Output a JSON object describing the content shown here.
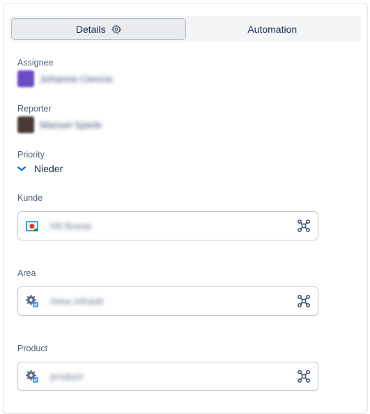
{
  "tabs": [
    {
      "label": "Details",
      "active": true
    },
    {
      "label": "Automation",
      "active": false
    }
  ],
  "fields": {
    "assignee": {
      "label": "Assignee",
      "value": "Johanna Ciencia"
    },
    "reporter": {
      "label": "Reporter",
      "value": "Manuel Spiele"
    },
    "priority": {
      "label": "Priority",
      "value": "Nieder",
      "icon": "chevron-down-icon",
      "color": "#0c66e4"
    },
    "kunde": {
      "label": "Kunde",
      "value": "Hit Busse",
      "icon": "customer-object-icon"
    },
    "area": {
      "label": "Area",
      "value": "Area Infrastr",
      "icon": "gear-object-icon"
    },
    "product": {
      "label": "Product",
      "value": "product",
      "icon": "gear-object-icon"
    }
  },
  "colors": {
    "accent": "#0c66e4",
    "border": "#c1c7d0",
    "label": "#505f79"
  }
}
